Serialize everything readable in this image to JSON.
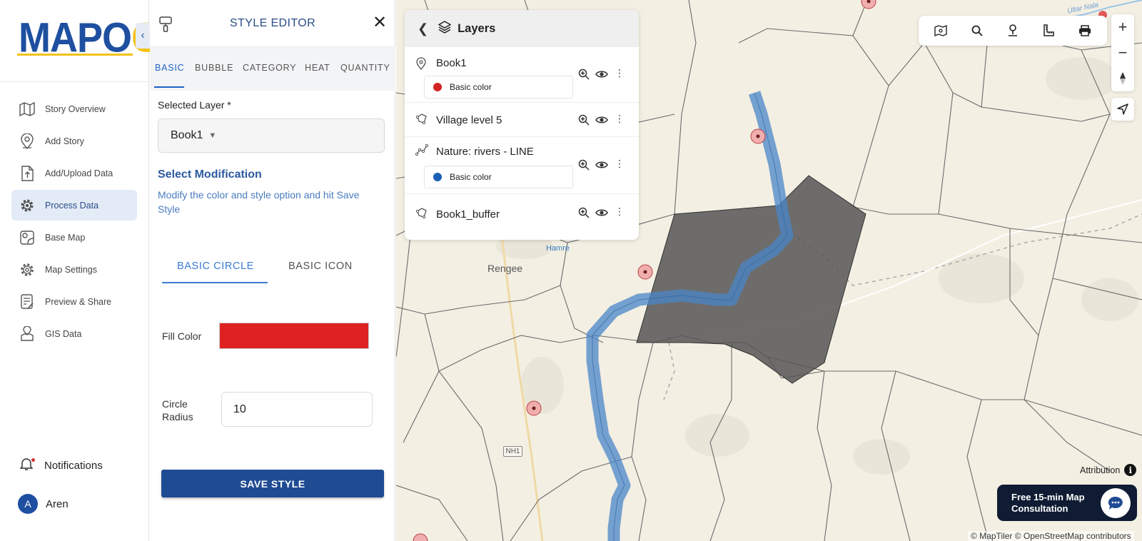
{
  "brand": {
    "logo_part1": "MAP",
    "logo_part2": "O",
    "logo_part3": "G"
  },
  "sidebar": {
    "items": [
      {
        "label": "Story Overview",
        "icon": "map-icon"
      },
      {
        "label": "Add Story",
        "icon": "location-pin-icon"
      },
      {
        "label": "Add/Upload Data",
        "icon": "upload-file-icon"
      },
      {
        "label": "Process Data",
        "icon": "gear-icon",
        "active": true
      },
      {
        "label": "Base Map",
        "icon": "base-map-icon"
      },
      {
        "label": "Map Settings",
        "icon": "settings-icon"
      },
      {
        "label": "Preview & Share",
        "icon": "preview-share-icon"
      },
      {
        "label": "GIS Data",
        "icon": "gis-data-icon"
      }
    ],
    "notifications_label": "Notifications",
    "user": {
      "initial": "A",
      "name": "Aren"
    }
  },
  "editor": {
    "title": "STYLE EDITOR",
    "tabs": [
      "BASIC",
      "BUBBLE",
      "CATEGORY",
      "HEAT",
      "QUANTITY"
    ],
    "active_tab": "BASIC",
    "selected_layer_label": "Selected Layer *",
    "selected_layer_value": "Book1",
    "modification_title": "Select Modification",
    "modification_desc": "Modify the color and style option and hit Save Style",
    "subtabs": [
      "BASIC CIRCLE",
      "BASIC ICON"
    ],
    "active_subtab": "BASIC CIRCLE",
    "fill_color_label": "Fill Color",
    "fill_color": "#de2222",
    "circle_radius_label": "Circle Radius",
    "circle_radius_value": "10",
    "save_label": "SAVE STYLE"
  },
  "layers_panel": {
    "title": "Layers",
    "layers": [
      {
        "name": "Book1",
        "icon": "point-layer-icon",
        "legend": {
          "label": "Basic color",
          "color": "#d32323"
        }
      },
      {
        "name": "Village level 5",
        "icon": "polygon-layer-icon"
      },
      {
        "name": "Nature: rivers - LINE",
        "icon": "line-layer-icon",
        "legend": {
          "label": "Basic color",
          "color": "#1a5fb4"
        }
      },
      {
        "name": "Book1_buffer",
        "icon": "polygon-layer-icon"
      }
    ]
  },
  "map": {
    "labels": {
      "rengee": "Rengee",
      "hamre": "Hamre",
      "nh1": "NH1",
      "nala": "Ultar Nala"
    },
    "attribution_label": "Attribution",
    "copyright": "© MapTiler © OpenStreetMap contributors",
    "consult_text": "Free 15-min Map Consultation"
  },
  "colors": {
    "brand_blue": "#1e4fa0",
    "brand_yellow": "#f5c21a",
    "accent": "#1e63c6",
    "buffer_fill": "#555555",
    "river": "#4a86c8"
  }
}
